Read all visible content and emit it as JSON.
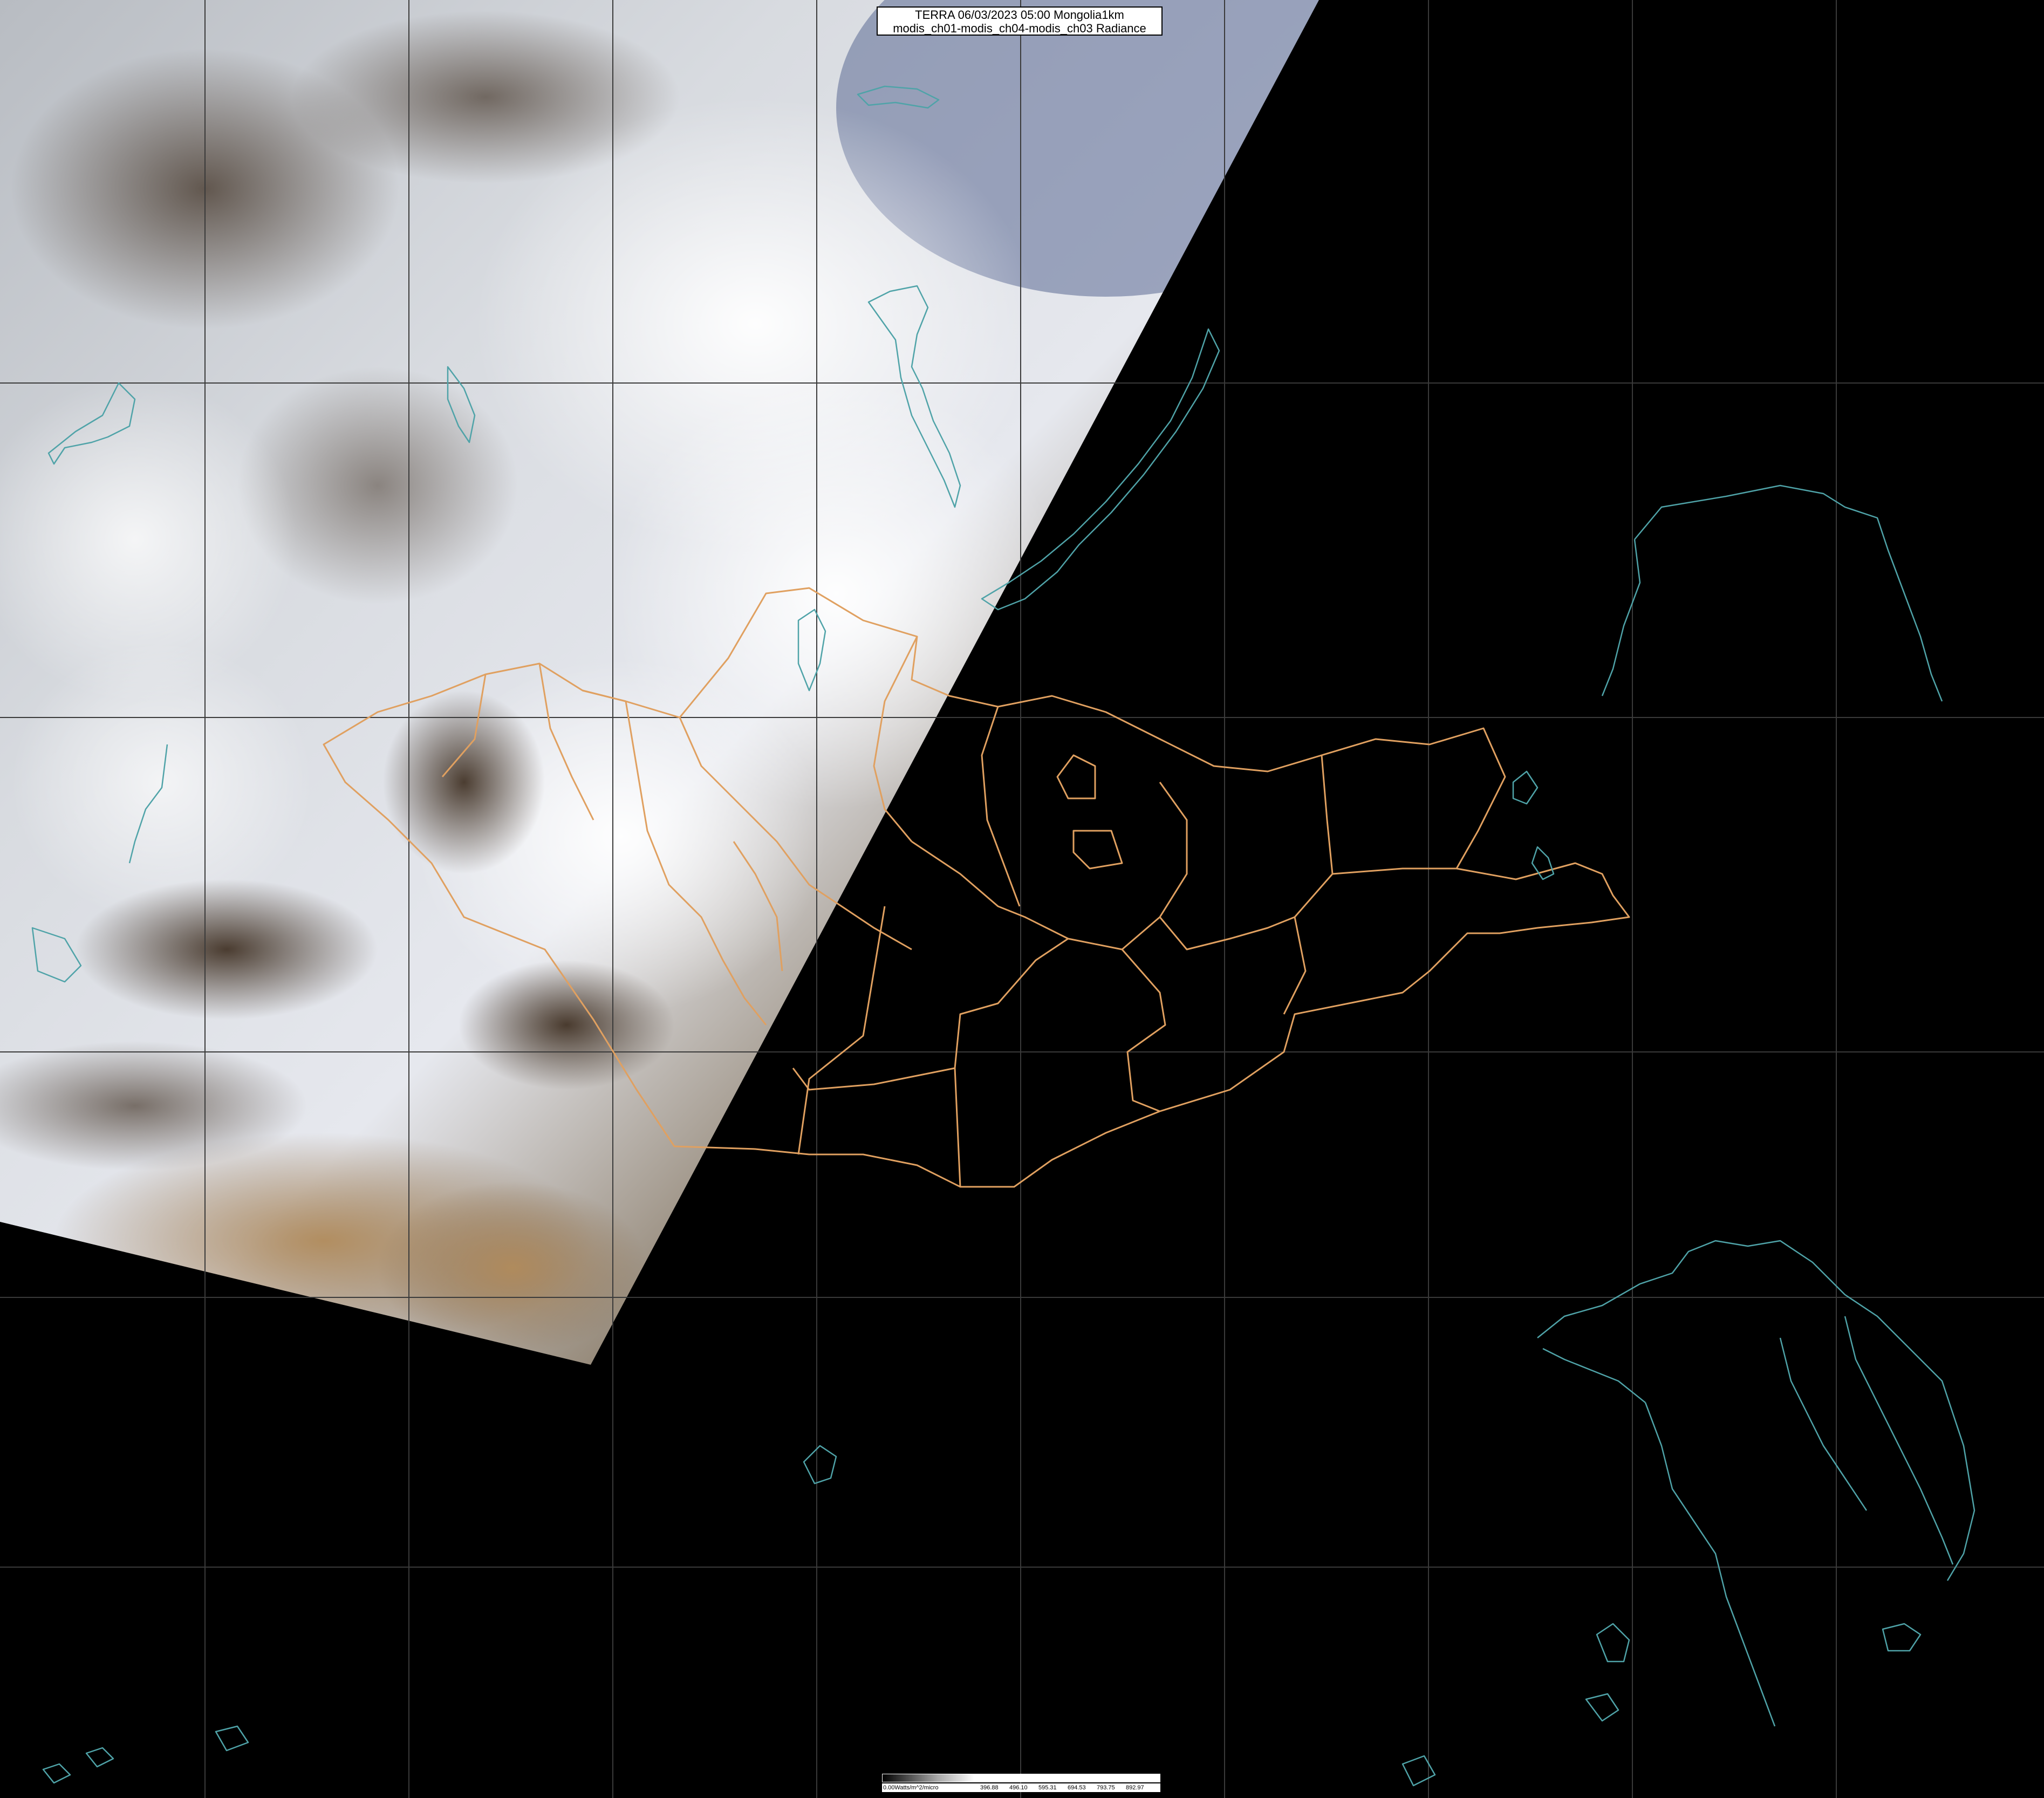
{
  "title": {
    "line1": "TERRA 06/03/2023 05:00 Mongolia1km",
    "line2": "modis_ch01-modis_ch04-modis_ch03 Radiance"
  },
  "colorbar": {
    "unit_label": "0.00Watts/m^2/micro",
    "ticks": [
      "396.88",
      "496.10",
      "595.31",
      "694.53",
      "793.75",
      "892.97"
    ]
  },
  "colors": {
    "grid": "#3a3a3a",
    "admin_border": "#e0a060",
    "coastline": "#4fa3a8",
    "background": "#000000"
  }
}
